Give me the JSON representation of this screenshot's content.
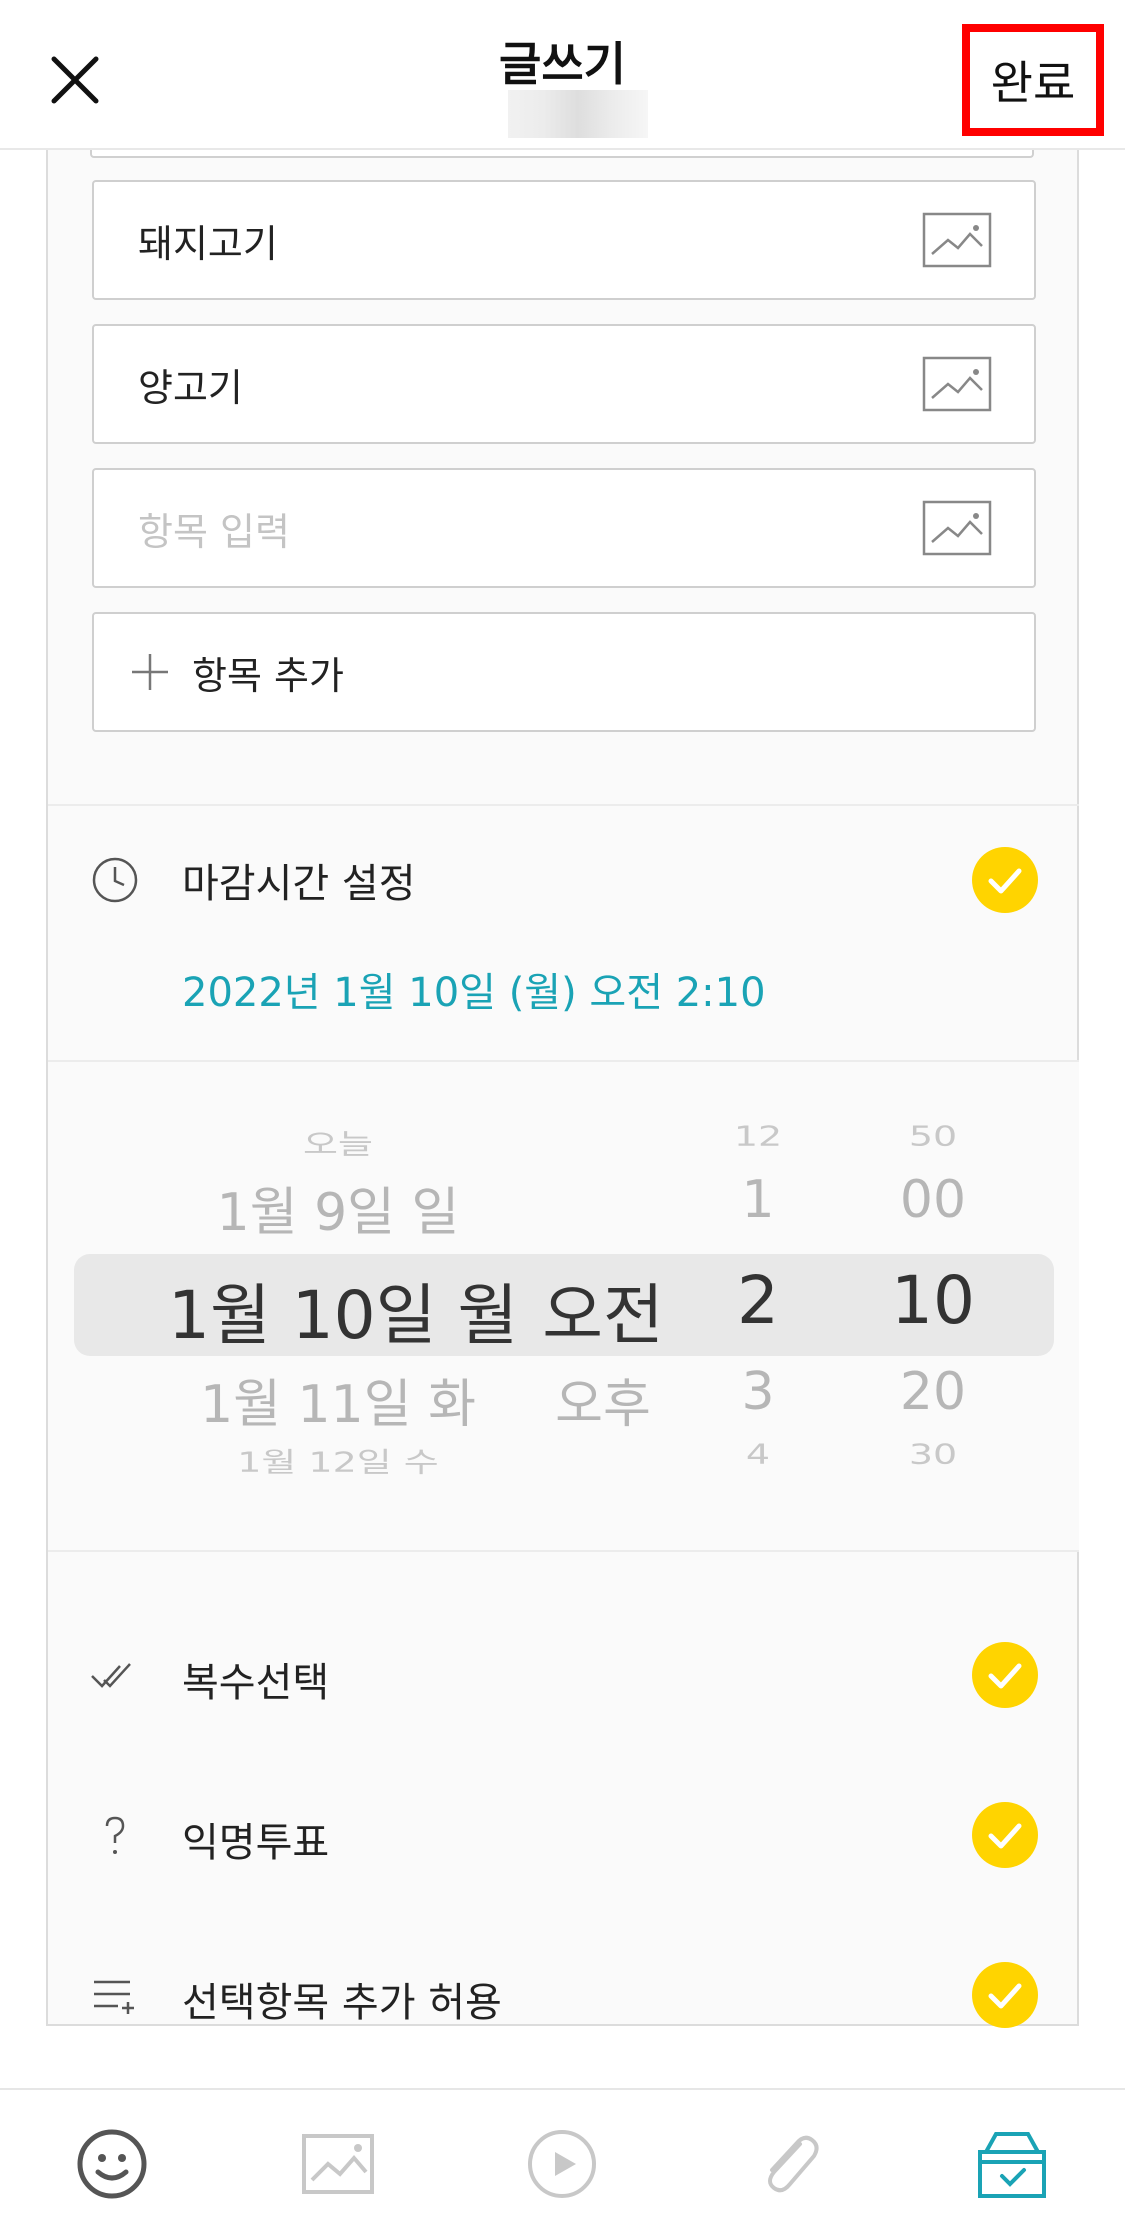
{
  "header": {
    "title": "글쓰기",
    "done_label": "완료"
  },
  "poll_options": [
    {
      "text": "돼지고기",
      "is_placeholder": false
    },
    {
      "text": "양고기",
      "is_placeholder": false
    },
    {
      "text": "항목 입력",
      "is_placeholder": true
    }
  ],
  "add_option_label": "항목 추가",
  "deadline": {
    "label": "마감시간 설정",
    "value": "2022년 1월 10일 (월) 오전 2:10",
    "enabled": true
  },
  "picker": {
    "dates": [
      "오늘",
      "1월 9일 일",
      "1월 10일 월",
      "1월 11일 화",
      "1월 12일 수"
    ],
    "ampm": [
      "오전",
      "오후"
    ],
    "hours": [
      "12",
      "1",
      "2",
      "3",
      "4"
    ],
    "minutes": [
      "50",
      "00",
      "10",
      "20",
      "30"
    ]
  },
  "settings": [
    {
      "label": "복수선택",
      "icon": "double-check-icon",
      "enabled": true
    },
    {
      "label": "익명투표",
      "icon": "question-icon",
      "enabled": true
    },
    {
      "label": "선택항목 추가 허용",
      "icon": "list-add-icon",
      "enabled": true
    }
  ],
  "toolbar": [
    "emoji-icon",
    "image-icon",
    "video-icon",
    "attach-icon",
    "vote-box-icon"
  ],
  "colors": {
    "accent_yellow": "#ffd400",
    "link_teal": "#1aa3b5",
    "done_highlight": "#ff0000"
  }
}
